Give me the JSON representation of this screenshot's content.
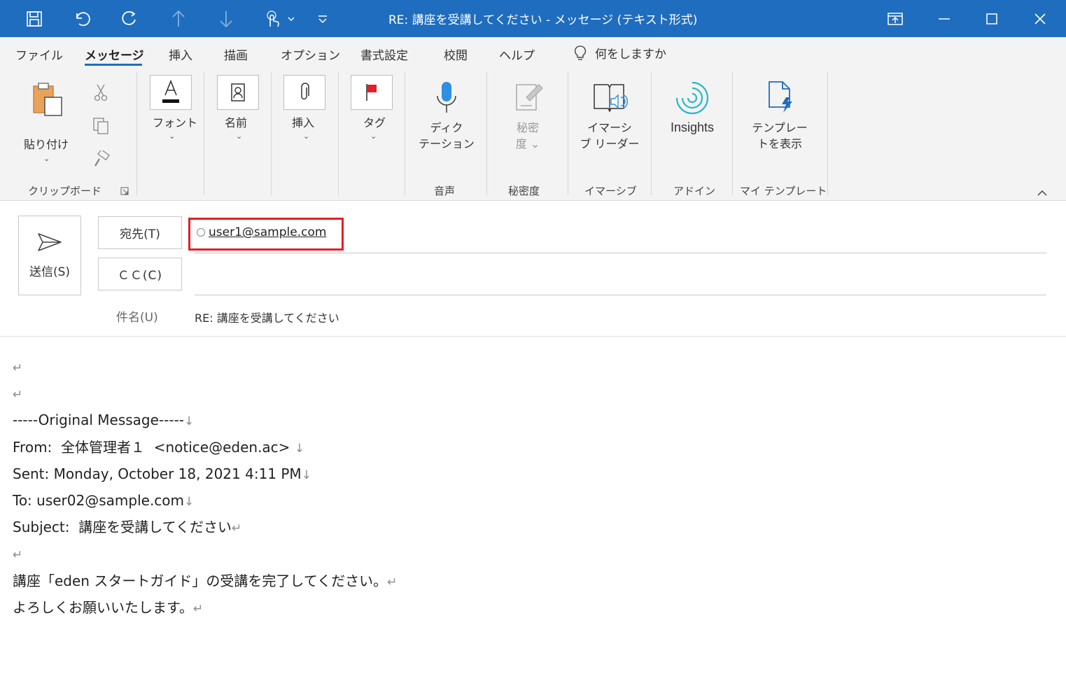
{
  "window": {
    "title": "RE: 講座を受講してください  -  メッセージ (テキスト形式)"
  },
  "menu": {
    "tabs": [
      "ファイル",
      "メッセージ",
      "挿入",
      "描画",
      "オプション",
      "書式設定",
      "校閲",
      "ヘルプ"
    ],
    "active_tab": "メッセージ",
    "tell_me": "何をしますか"
  },
  "ribbon": {
    "paste": "貼り付け",
    "clipboard_group": "クリップボード",
    "font": "フォント",
    "names": "名前",
    "insert": "挿入",
    "tags": "タグ",
    "dictate_line1": "ディク",
    "dictate_line2": "テーション",
    "voice_group": "音声",
    "sensitivity_line1": "秘密",
    "sensitivity_line2": "度 ⌄",
    "sensitivity_group": "秘密度",
    "immersive_line1": "イマーシ",
    "immersive_line2": "ブ リーダー",
    "immersive_group": "イマーシブ",
    "insights": "Insights",
    "addin_group": "アドイン",
    "templates_line1": "テンプレー",
    "templates_line2": "トを表示",
    "templates_group": "マイ テンプレート"
  },
  "compose": {
    "send": "送信(S)",
    "to_button": "宛先(T)",
    "cc_button": "ＣＣ(C)",
    "subject_label": "件名(U)",
    "to_value": "user1@sample.com",
    "subject_value": "RE: 講座を受講してください"
  },
  "body_lines": [
    "",
    "",
    "-----Original Message-----",
    "From:  全体管理者１  <notice@eden.ac> ",
    "Sent: Monday, October 18, 2021 4:11 PM",
    "To: user02@sample.com",
    "Subject:  講座を受講してください",
    "",
    "講座「eden スタートガイド」の受講を完了してください。",
    "よろしくお願いいたします。"
  ],
  "body_marks": [
    "↵",
    "↵",
    "↓",
    "↓",
    "↓",
    "↓",
    "↵",
    "↵",
    "↵",
    "↵"
  ],
  "colors": {
    "titlebar": "#1f6dbf",
    "highlight": "#e0202a"
  }
}
